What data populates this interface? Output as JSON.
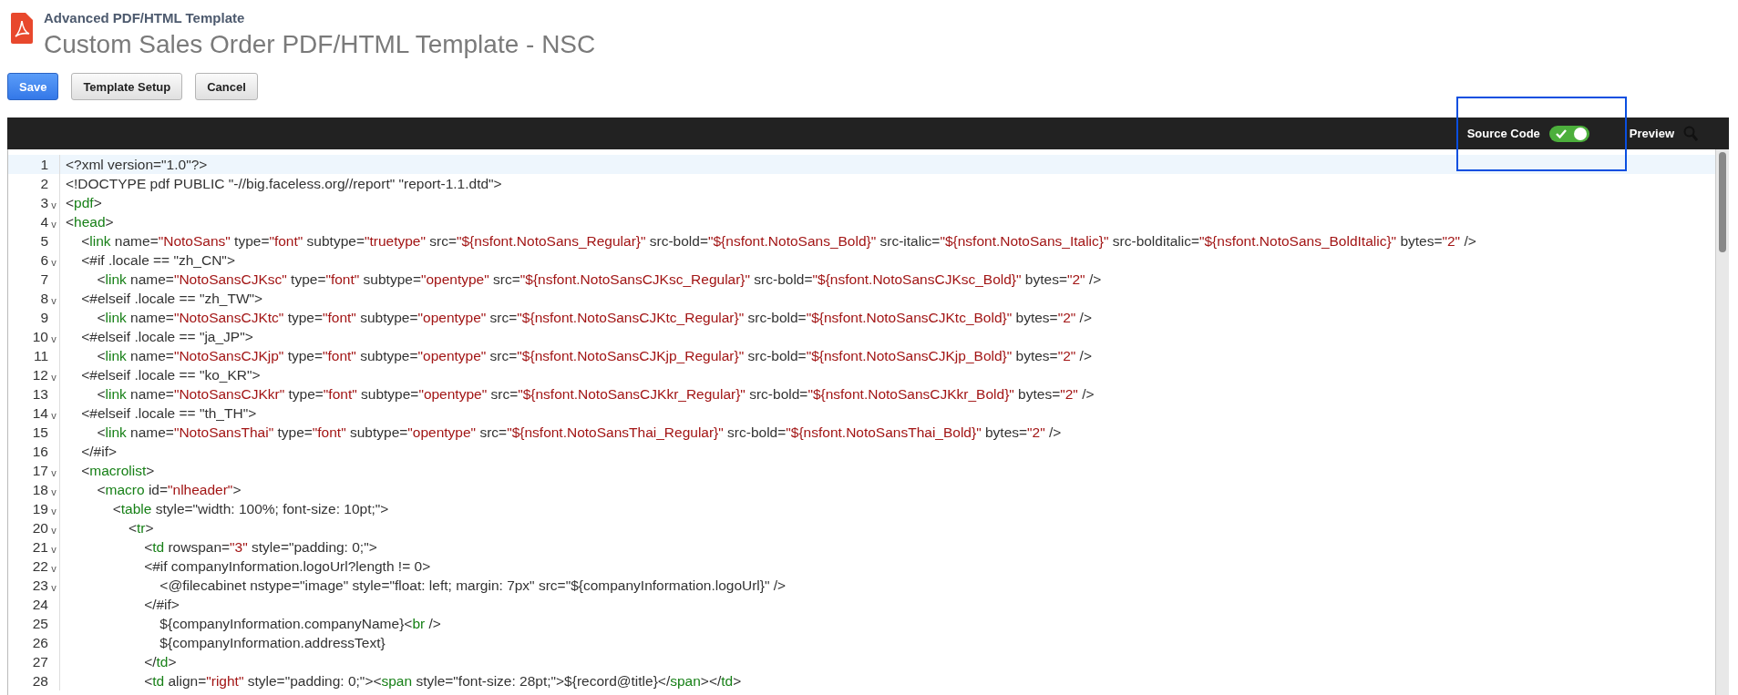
{
  "header": {
    "record_type": "Advanced PDF/HTML Template",
    "title": "Custom Sales Order PDF/HTML Template - NSC"
  },
  "buttons": [
    {
      "label": "Save",
      "primary": true
    },
    {
      "label": "Template Setup",
      "primary": false
    },
    {
      "label": "Cancel",
      "primary": false
    }
  ],
  "toolbar": {
    "source_code_toggle": {
      "label": "Source Code",
      "on": true,
      "highlighted": true
    },
    "preview": {
      "label": "Preview"
    }
  },
  "editor": {
    "lines": [
      {
        "number": "1",
        "text": "<?xml version=\"1.0\"?>",
        "current": true
      },
      {
        "number": "2",
        "text": "<!DOCTYPE pdf PUBLIC \"-//big.faceless.org//report\" \"report-1.1.dtd\">",
        "current": false
      },
      {
        "number": "3",
        "fold_marker": "v",
        "text": "<pdf>",
        "current": false
      },
      {
        "number": "4",
        "fold_marker": "v",
        "text": "<head>",
        "current": false
      },
      {
        "number": "5",
        "text": "    <link name=\"NotoSans\" type=\"font\" subtype=\"truetype\" src=\"${nsfont.NotoSans_Regular}\" src-bold=\"${nsfont.NotoSans_Bold}\" src-italic=\"${nsfont.NotoSans_Italic}\" src-bolditalic=\"${nsfont.NotoSans_BoldItalic}\" bytes=\"2\" />",
        "current": false
      },
      {
        "number": "6",
        "fold_marker": "v",
        "text": "    <#if .locale == \"zh_CN\">",
        "current": false
      },
      {
        "number": "7",
        "text": "        <link name=\"NotoSansCJKsc\" type=\"font\" subtype=\"opentype\" src=\"${nsfont.NotoSansCJKsc_Regular}\" src-bold=\"${nsfont.NotoSansCJKsc_Bold}\" bytes=\"2\" />",
        "current": false
      },
      {
        "number": "8",
        "fold_marker": "v",
        "text": "    <#elseif .locale == \"zh_TW\">",
        "current": false
      },
      {
        "number": "9",
        "text": "        <link name=\"NotoSansCJKtc\" type=\"font\" subtype=\"opentype\" src=\"${nsfont.NotoSansCJKtc_Regular}\" src-bold=\"${nsfont.NotoSansCJKtc_Bold}\" bytes=\"2\" />",
        "current": false
      },
      {
        "number": "10",
        "fold_marker": "v",
        "text": "    <#elseif .locale == \"ja_JP\">",
        "current": false
      },
      {
        "number": "11",
        "text": "        <link name=\"NotoSansCJKjp\" type=\"font\" subtype=\"opentype\" src=\"${nsfont.NotoSansCJKjp_Regular}\" src-bold=\"${nsfont.NotoSansCJKjp_Bold}\" bytes=\"2\" />",
        "current": false
      },
      {
        "number": "12",
        "fold_marker": "v",
        "text": "    <#elseif .locale == \"ko_KR\">",
        "current": false
      },
      {
        "number": "13",
        "text": "        <link name=\"NotoSansCJKkr\" type=\"font\" subtype=\"opentype\" src=\"${nsfont.NotoSansCJKkr_Regular}\" src-bold=\"${nsfont.NotoSansCJKkr_Bold}\" bytes=\"2\" />",
        "current": false
      },
      {
        "number": "14",
        "fold_marker": "v",
        "text": "    <#elseif .locale == \"th_TH\">",
        "current": false
      },
      {
        "number": "15",
        "text": "        <link name=\"NotoSansThai\" type=\"font\" subtype=\"opentype\" src=\"${nsfont.NotoSansThai_Regular}\" src-bold=\"${nsfont.NotoSansThai_Bold}\" bytes=\"2\" />",
        "current": false
      },
      {
        "number": "16",
        "text": "    </#if>",
        "current": false
      },
      {
        "number": "17",
        "fold_marker": "v",
        "text": "    <macrolist>",
        "current": false
      },
      {
        "number": "18",
        "fold_marker": "v",
        "text": "        <macro id=\"nlheader\">",
        "current": false
      },
      {
        "number": "19",
        "fold_marker": "v",
        "text": "            <table style=\"width: 100%; font-size: 10pt;\">",
        "current": false
      },
      {
        "number": "20",
        "fold_marker": "v",
        "text": "                <tr>",
        "current": false
      },
      {
        "number": "21",
        "fold_marker": "v",
        "text": "                    <td rowspan=\"3\" style=\"padding: 0;\">",
        "current": false
      },
      {
        "number": "22",
        "fold_marker": "v",
        "text": "                    <#if companyInformation.logoUrl?length != 0>",
        "current": false
      },
      {
        "number": "23",
        "fold_marker": "v",
        "text": "                        <@filecabinet nstype=\"image\" style=\"float: left; margin: 7px\" src=\"${companyInformation.logoUrl}\" />",
        "current": false
      },
      {
        "number": "24",
        "text": "                    </#if>",
        "current": false
      },
      {
        "number": "25",
        "text": "                        ${companyInformation.companyName}<br />",
        "current": false
      },
      {
        "number": "26",
        "text": "                        ${companyInformation.addressText}",
        "current": false
      },
      {
        "number": "27",
        "text": "                    </td>",
        "current": false
      },
      {
        "number": "28",
        "text": "                    <td align=\"right\" style=\"padding: 0;\"><span style=\"font-size: 28pt;\">${record@title}</span></td>",
        "current": false
      }
    ]
  }
}
